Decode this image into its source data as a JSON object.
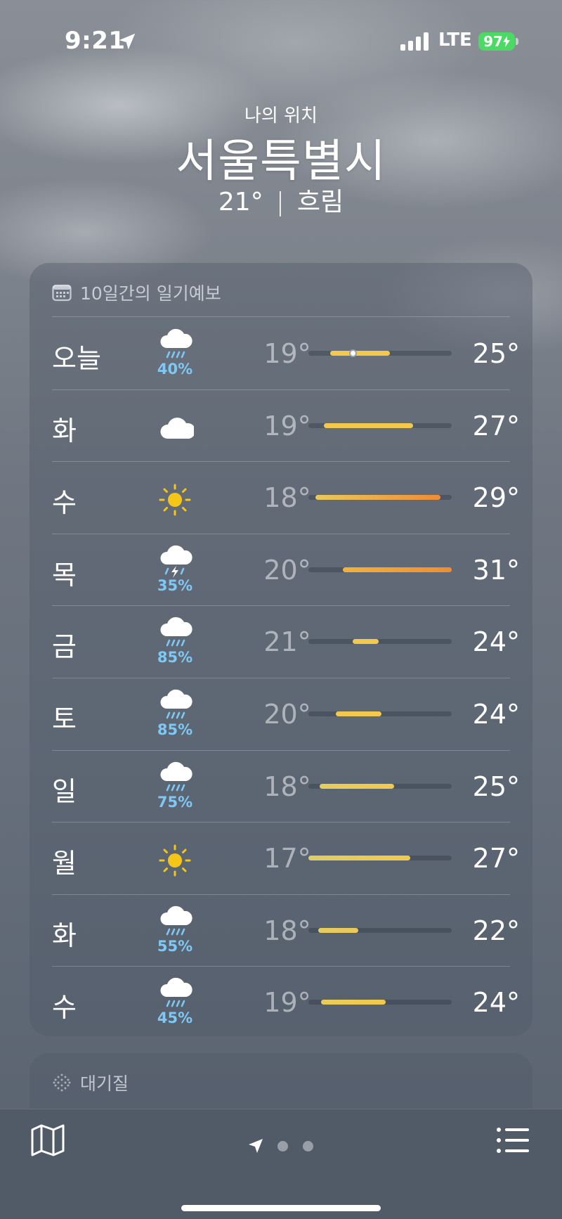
{
  "status_bar": {
    "time": "9:21",
    "network": "LTE",
    "battery": "97"
  },
  "header": {
    "location_label": "나의 위치",
    "city": "서울특별시",
    "temperature": "21°",
    "separator": "|",
    "condition": "흐림"
  },
  "forecast": {
    "title": "10일간의 일기예보",
    "icon": "calendar-icon",
    "days": [
      {
        "day": "오늘",
        "icon": "cloud-rain-icon",
        "precip": "40%",
        "low": "19°",
        "high": "25°",
        "bar_start": 0.15,
        "bar_end": 0.57,
        "current": 0.31,
        "colors": [
          "#f2c94c",
          "#f2c94c"
        ]
      },
      {
        "day": "화",
        "icon": "cloud-icon",
        "precip": "",
        "low": "19°",
        "high": "27°",
        "bar_start": 0.11,
        "bar_end": 0.73,
        "colors": [
          "#f2c94c",
          "#f2c94c"
        ]
      },
      {
        "day": "수",
        "icon": "sun-icon",
        "precip": "",
        "low": "18°",
        "high": "29°",
        "bar_start": 0.05,
        "bar_end": 0.92,
        "colors": [
          "#e8c95a",
          "#ef8c34"
        ]
      },
      {
        "day": "목",
        "icon": "cloud-bolt-rain-icon",
        "precip": "35%",
        "low": "20°",
        "high": "31°",
        "bar_start": 0.24,
        "bar_end": 1.0,
        "colors": [
          "#f2b23c",
          "#ef8c34"
        ]
      },
      {
        "day": "금",
        "icon": "cloud-rain-icon",
        "precip": "85%",
        "low": "21°",
        "high": "24°",
        "bar_start": 0.31,
        "bar_end": 0.49,
        "colors": [
          "#f2c94c",
          "#f2c94c"
        ]
      },
      {
        "day": "토",
        "icon": "cloud-rain-icon",
        "precip": "85%",
        "low": "20°",
        "high": "24°",
        "bar_start": 0.19,
        "bar_end": 0.51,
        "colors": [
          "#f2c94c",
          "#f2c94c"
        ]
      },
      {
        "day": "일",
        "icon": "cloud-rain-icon",
        "precip": "75%",
        "low": "18°",
        "high": "25°",
        "bar_start": 0.08,
        "bar_end": 0.6,
        "colors": [
          "#e6cd5e",
          "#f2c94c"
        ]
      },
      {
        "day": "월",
        "icon": "sun-icon",
        "precip": "",
        "low": "17°",
        "high": "27°",
        "bar_start": 0.0,
        "bar_end": 0.71,
        "colors": [
          "#dccd6a",
          "#f2c94c"
        ]
      },
      {
        "day": "화",
        "icon": "cloud-rain-icon",
        "precip": "55%",
        "low": "18°",
        "high": "22°",
        "bar_start": 0.07,
        "bar_end": 0.35,
        "colors": [
          "#e6cd5e",
          "#e9c95a"
        ]
      },
      {
        "day": "수",
        "icon": "cloud-rain-icon",
        "precip": "45%",
        "low": "19°",
        "high": "24°",
        "bar_start": 0.09,
        "bar_end": 0.54,
        "colors": [
          "#e9cc5a",
          "#f2c94c"
        ]
      }
    ]
  },
  "air_quality": {
    "title": "대기질",
    "icon": "dots-grid-icon"
  },
  "toolbar": {
    "map_icon": "map-icon",
    "location_icon": "location-arrow-icon",
    "pages": 2,
    "list_icon": "list-icon"
  }
}
